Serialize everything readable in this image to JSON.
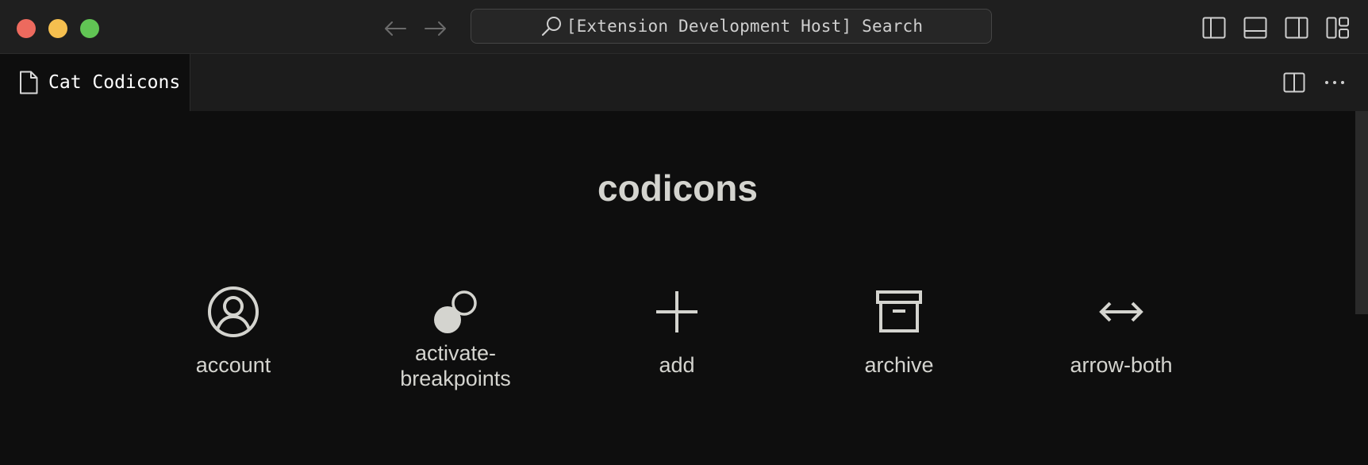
{
  "titlebar": {
    "search_text": "[Extension Development Host] Search"
  },
  "tabs": [
    {
      "label": "Cat Codicons",
      "active": true
    }
  ],
  "page": {
    "title": "codicons",
    "icons": [
      {
        "name": "account",
        "icon": "account-icon"
      },
      {
        "name": "activate-\nbreakpoints",
        "icon": "activate-breakpoints-icon"
      },
      {
        "name": "add",
        "icon": "add-icon"
      },
      {
        "name": "archive",
        "icon": "archive-icon"
      },
      {
        "name": "arrow-both",
        "icon": "arrow-both-icon"
      }
    ]
  },
  "colors": {
    "background": "#0e0e0e",
    "titlebar": "#1f1f1f",
    "text": "#d4d4cf",
    "close": "#ed6a5e",
    "minimize": "#f5bf4f",
    "maximize": "#61c554"
  }
}
